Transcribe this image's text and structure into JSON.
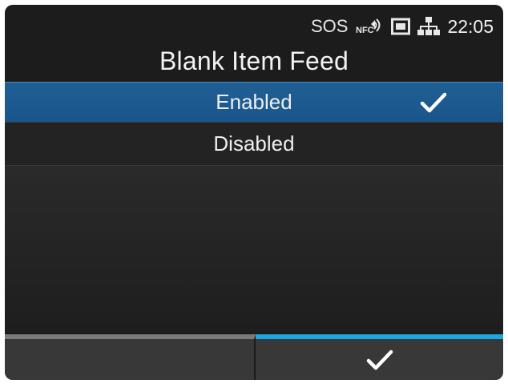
{
  "status_bar": {
    "sos_label": "SOS",
    "nfc_label": "NFC",
    "time": "22:05",
    "icons": [
      "nfc-icon",
      "memory-card-icon",
      "lan-icon"
    ]
  },
  "screen": {
    "title": "Blank Item Feed"
  },
  "options": [
    {
      "label": "Enabled",
      "selected": true
    },
    {
      "label": "Disabled",
      "selected": false
    }
  ],
  "softkeys": {
    "left": {
      "label": ""
    },
    "right": {
      "icon": "check-icon"
    }
  },
  "colors": {
    "background": "#1c1c1c",
    "selected_row": "#1a558a",
    "accent": "#1aa7e6",
    "softkey_bg": "#383838",
    "text": "#eeeeee"
  }
}
